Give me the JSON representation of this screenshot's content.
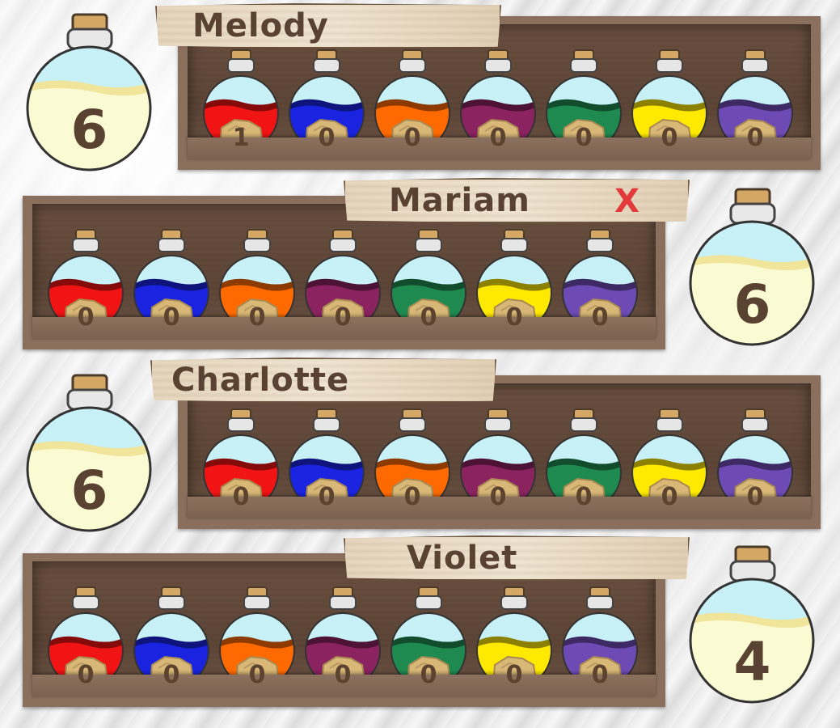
{
  "colors": {
    "bottle_glass": "#c8f1f7",
    "counter_liquid": "#fbfbd3",
    "text_brown": "#5a4232",
    "mark_red": "#e23a3a"
  },
  "potion_colors": [
    "#f11414",
    "#1a24e0",
    "#ff6a00",
    "#8b2361",
    "#1f8a50",
    "#ffe900",
    "#6e4bb4"
  ],
  "players": [
    {
      "name": "Melody",
      "mark": "",
      "score": "6",
      "potions": [
        "1",
        "0",
        "0",
        "0",
        "0",
        "0",
        "0"
      ]
    },
    {
      "name": "Mariam",
      "mark": "X",
      "score": "6",
      "potions": [
        "0",
        "0",
        "0",
        "0",
        "0",
        "0",
        "0"
      ]
    },
    {
      "name": "Charlotte",
      "mark": "",
      "score": "6",
      "potions": [
        "0",
        "0",
        "0",
        "0",
        "0",
        "0",
        "0"
      ]
    },
    {
      "name": "Violet",
      "mark": "",
      "score": "4",
      "potions": [
        "0",
        "0",
        "0",
        "0",
        "0",
        "0",
        "0"
      ]
    }
  ]
}
